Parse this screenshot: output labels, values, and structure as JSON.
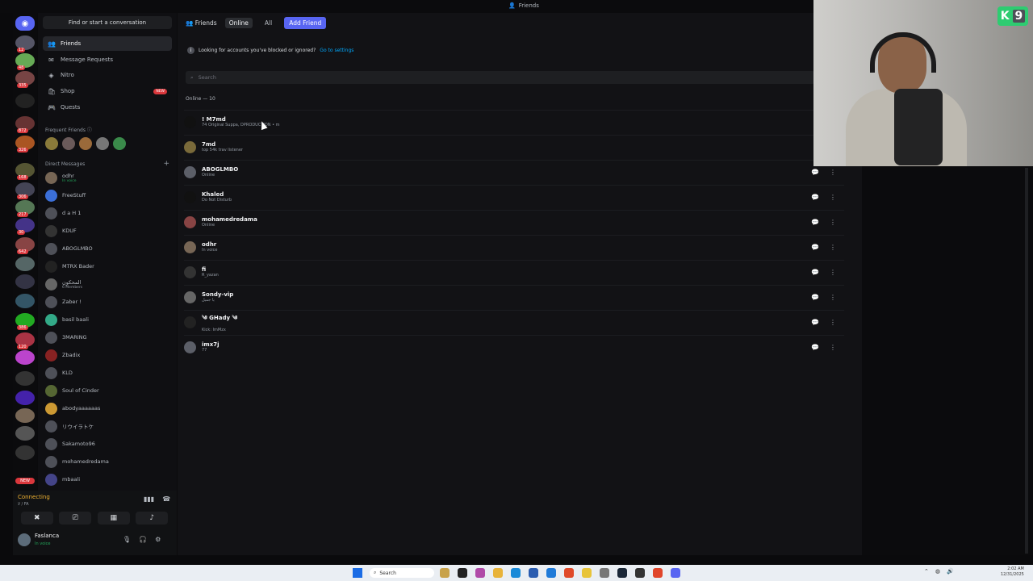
{
  "window": {
    "title": "Friends"
  },
  "sidebar": {
    "search_button": "Find or start a conversation",
    "nav": [
      {
        "label": "Friends",
        "icon": "friends-icon"
      },
      {
        "label": "Message Requests",
        "icon": "mail-icon"
      },
      {
        "label": "Nitro",
        "icon": "nitro-icon"
      },
      {
        "label": "Shop",
        "icon": "shop-icon",
        "badge": "NEW"
      },
      {
        "label": "Quests",
        "icon": "quests-icon"
      }
    ],
    "frequent_friends_label": "Frequent Friends",
    "direct_messages_label": "Direct Messages",
    "add_dm": "+",
    "dms": [
      {
        "name": "odhr",
        "sub": "In voice"
      },
      {
        "name": "FreeStuff",
        "sub": ""
      },
      {
        "name": "‫1 d a H",
        "sub": ""
      },
      {
        "name": "KDUF",
        "sub": ""
      },
      {
        "name": "ABOGLMBO",
        "sub": ""
      },
      {
        "name": "MTRX Bader",
        "sub": ""
      },
      {
        "name": "المحكون",
        "sub": "6 Members"
      },
      {
        "name": "Zaber !",
        "sub": ""
      },
      {
        "name": "basil baali",
        "sub": ""
      },
      {
        "name": "3MARING",
        "sub": ""
      },
      {
        "name": "Zbadix",
        "sub": ""
      },
      {
        "name": "KLD",
        "sub": ""
      },
      {
        "name": "Soul of Cinder",
        "sub": ""
      },
      {
        "name": "abodyaaaaaas",
        "sub": ""
      },
      {
        "name": "リウイラトケ",
        "sub": ""
      },
      {
        "name": "Sakamoto96",
        "sub": ""
      },
      {
        "name": "mohamedredama",
        "sub": ""
      },
      {
        "name": "mbaali",
        "sub": ""
      }
    ]
  },
  "server_rail": {
    "badges": [
      "12",
      "48",
      "335",
      "872",
      "326",
      "168",
      "306",
      "217",
      "30",
      "642",
      "386",
      "120",
      "28"
    ],
    "new_label": "NEW"
  },
  "voice_panel": {
    "status": "Connecting",
    "sub": "لا / FA",
    "user_name": "Faslаnca",
    "user_status": "In voice"
  },
  "topbar": {
    "friends_label": "Friends",
    "tabs": [
      "Online",
      "All"
    ],
    "add_friend": "Add Friend"
  },
  "notice": {
    "text": "Looking for accounts you've blocked or ignored?",
    "link": "Go to settings"
  },
  "search": {
    "placeholder": "Search"
  },
  "online_header": "Online — 10",
  "friends": [
    {
      "name": "! M7md",
      "status": "74 Original Suppa, DPRODUCTION • m"
    },
    {
      "name": "7md",
      "status": "top 54k trav listener"
    },
    {
      "name": "ABOGLMBO",
      "status": "Online"
    },
    {
      "name": "Khaled",
      "status": "Do Not Disturb"
    },
    {
      "name": "mohamedredama",
      "status": "Online"
    },
    {
      "name": "odhr",
      "status": "In voice"
    },
    {
      "name": "fi",
      "status": "R_yazan"
    },
    {
      "name": "Sondy-vip",
      "status": "يا جميل"
    },
    {
      "name": "༄ GHady ༄",
      "status": "Kick: ImMzx"
    },
    {
      "name": "imx7j",
      "status": "77"
    }
  ],
  "webcam": {
    "logo_letter": "K",
    "logo_number": "9"
  },
  "taskbar": {
    "search": "Search",
    "time": "2:02 AM",
    "date": "12/31/2025"
  }
}
